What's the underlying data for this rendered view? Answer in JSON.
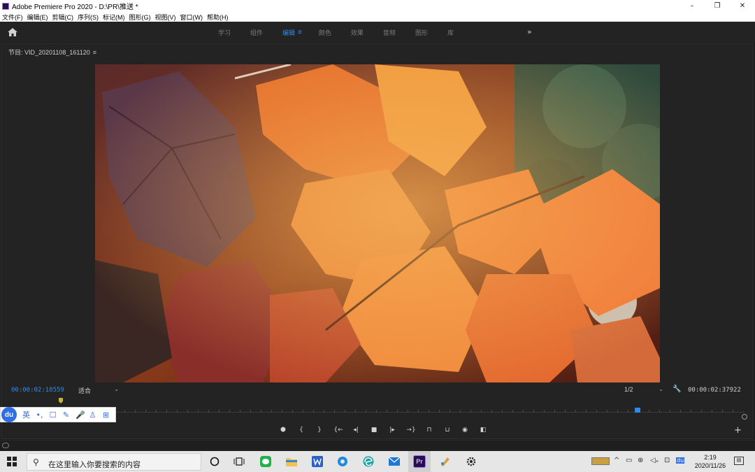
{
  "titlebar": {
    "title": "Adobe Premiere Pro 2020 - D:\\PR\\推送 *",
    "minimize": "–",
    "restore": "❐",
    "close": "✕"
  },
  "menu": [
    "文件(F)",
    "编辑(E)",
    "剪辑(C)",
    "序列(S)",
    "标记(M)",
    "图形(G)",
    "视图(V)",
    "窗口(W)",
    "帮助(H)"
  ],
  "workspace": {
    "tabs": [
      "学习",
      "组件",
      "编辑",
      "颜色",
      "效果",
      "音频",
      "图形",
      "库"
    ],
    "active_index": 2,
    "tab_menu_glyph": "≡",
    "more_glyph": "»"
  },
  "program_monitor": {
    "title": "节目: VID_20201108_161120",
    "title_menu_glyph": "≡",
    "timecode_current": "00:00:02:18559",
    "timecode_duration": "00:00:02:37922",
    "zoom_select": "适合",
    "resolution_select": "1/2"
  },
  "transport_icons": [
    "marker-icon",
    "mark-in-icon",
    "mark-out-icon",
    "go-to-in-icon",
    "step-back-icon",
    "stop-icon",
    "step-forward-icon",
    "go-to-out-icon",
    "lift-icon",
    "extract-icon",
    "export-frame-icon",
    "compare-icon"
  ],
  "transport_glyphs": [
    "⬢",
    "{",
    "}",
    "{←",
    "◂|",
    "■",
    "|▸",
    "→}",
    "⊓",
    "⊔",
    "◉",
    "◧"
  ],
  "add_button_glyph": "+",
  "ime": {
    "logo": "du",
    "items": [
      "英",
      "•,",
      "☐",
      "✎",
      "🎤",
      "♙",
      "⊞"
    ]
  },
  "taskbar": {
    "search_placeholder": "在这里输入你要搜索的内容",
    "search_glyph": "⚲",
    "premiere_label": "Pr",
    "battery_glyph": "▭",
    "time": "2:19",
    "date": "2020/11/26",
    "notification_glyph": "▤"
  },
  "colors": {
    "accent_blue": "#2d8ceb",
    "panel_bg": "#232323",
    "playhead": "#c9b53a"
  }
}
